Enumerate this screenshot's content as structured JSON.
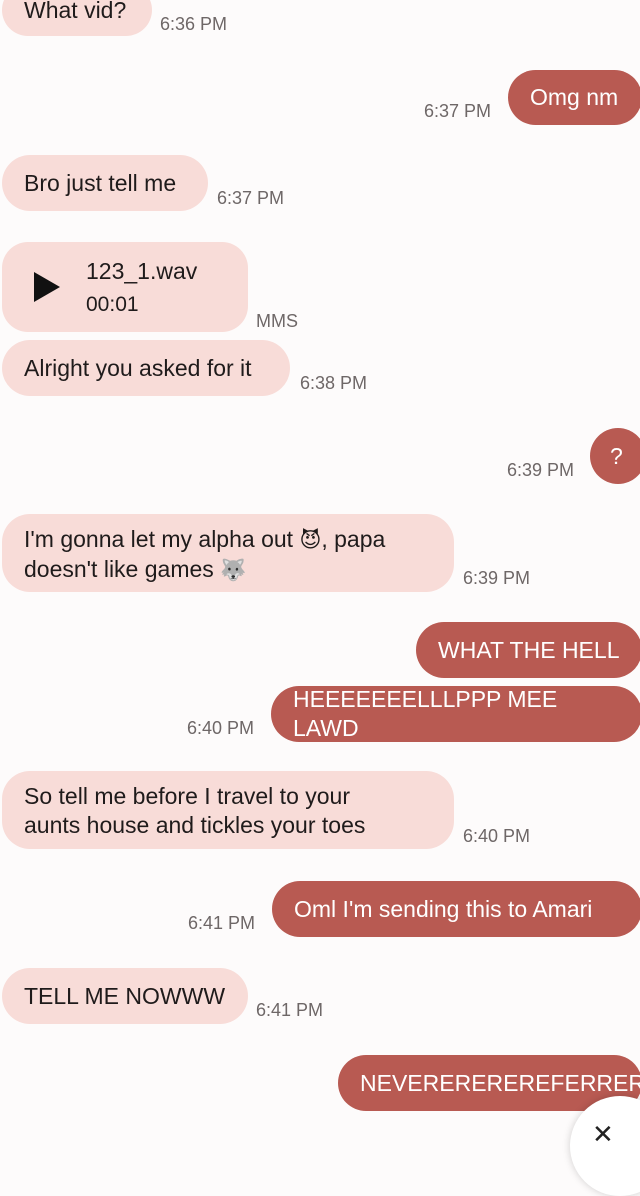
{
  "messages": [
    {
      "dir": "in",
      "text": "What vid?",
      "time": "6:36 PM"
    },
    {
      "dir": "out",
      "text": "Omg nm",
      "time": "6:37 PM"
    },
    {
      "dir": "in",
      "text": "Bro just tell me",
      "time": "6:37 PM"
    },
    {
      "dir": "in",
      "type": "audio",
      "file": "123_1.wav",
      "duration": "00:01",
      "tag": "MMS",
      "icon": "play-icon"
    },
    {
      "dir": "in",
      "text": "Alright you asked for it",
      "time": "6:38 PM"
    },
    {
      "dir": "out",
      "text": "?",
      "time": "6:39 PM"
    },
    {
      "dir": "in",
      "line1": "I'm gonna let my alpha out",
      "emoji1": "😈",
      "line1b": ", papa",
      "line2": "doesn't like games",
      "emoji2": "🐺",
      "time": "6:39 PM"
    },
    {
      "dir": "out",
      "text": "WHAT THE HELL"
    },
    {
      "dir": "out",
      "text": "HEEEEEEELLLPPP MEE LAWD",
      "time": "6:40 PM"
    },
    {
      "dir": "in",
      "line1": "So tell me before I travel to your",
      "line2": "aunts house and tickles your toes",
      "time": "6:40 PM"
    },
    {
      "dir": "out",
      "text": "Oml I'm sending this to Amari",
      "time": "6:41 PM"
    },
    {
      "dir": "in",
      "text": "TELL ME NOWWW",
      "time": "6:41 PM"
    },
    {
      "dir": "out",
      "text": "NEVEREREREREFERRER"
    }
  ],
  "scroll_button": {
    "icon": "chevron-down-icon",
    "glyph": "✕"
  },
  "colors": {
    "incoming": "#f8dcd8",
    "outgoing": "#b85a52",
    "background": "#fdfbfb"
  }
}
